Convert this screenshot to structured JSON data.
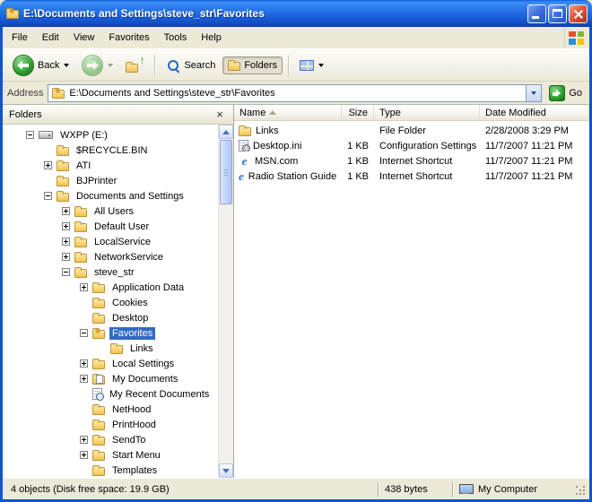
{
  "theme": {
    "titlebar_blue": "#2e7ef0",
    "window_border_blue": "#0f55cc",
    "chrome_beige": "#ece9d8",
    "selection_blue": "#316ac5",
    "close_button_red": "#da5a3c",
    "nav_button_green": "#2a9b2a"
  },
  "window": {
    "title": "E:\\Documents and Settings\\steve_str\\Favorites"
  },
  "menu": {
    "items": [
      "File",
      "Edit",
      "View",
      "Favorites",
      "Tools",
      "Help"
    ]
  },
  "toolbar": {
    "buttons": [
      {
        "label": "Back",
        "icon": "back-arrow-icon",
        "enabled": true
      },
      {
        "label": "",
        "icon": "forward-arrow-icon",
        "enabled": false
      },
      {
        "label": "",
        "icon": "up-folder-icon",
        "enabled": true
      },
      {
        "label": "Search",
        "icon": "search-icon",
        "enabled": true
      },
      {
        "label": "Folders",
        "icon": "folders-icon",
        "enabled": true,
        "pressed": true
      },
      {
        "label": "",
        "icon": "views-icon",
        "enabled": true
      }
    ]
  },
  "address": {
    "label": "Address",
    "value": "E:\\Documents and Settings\\steve_str\\Favorites",
    "go": "Go"
  },
  "folders_pane": {
    "title": "Folders",
    "tree": [
      {
        "label": "WXPP (E:)",
        "level": 0,
        "expand": "minus",
        "icon": "drive"
      },
      {
        "label": "$RECYCLE.BIN",
        "level": 1,
        "expand": "none",
        "icon": "folder"
      },
      {
        "label": "ATI",
        "level": 1,
        "expand": "plus",
        "icon": "folder"
      },
      {
        "label": "BJPrinter",
        "level": 1,
        "expand": "none",
        "icon": "folder"
      },
      {
        "label": "Documents and Settings",
        "level": 1,
        "expand": "minus",
        "icon": "folder-open"
      },
      {
        "label": "All Users",
        "level": 2,
        "expand": "plus",
        "icon": "folder"
      },
      {
        "label": "Default User",
        "level": 2,
        "expand": "plus",
        "icon": "folder"
      },
      {
        "label": "LocalService",
        "level": 2,
        "expand": "plus",
        "icon": "folder"
      },
      {
        "label": "NetworkService",
        "level": 2,
        "expand": "plus",
        "icon": "folder"
      },
      {
        "label": "steve_str",
        "level": 2,
        "expand": "minus",
        "icon": "folder-open"
      },
      {
        "label": "Application Data",
        "level": 3,
        "expand": "plus",
        "icon": "folder"
      },
      {
        "label": "Cookies",
        "level": 3,
        "expand": "none",
        "icon": "folder"
      },
      {
        "label": "Desktop",
        "level": 3,
        "expand": "none",
        "icon": "folder"
      },
      {
        "label": "Favorites",
        "level": 3,
        "expand": "minus",
        "icon": "favorites",
        "selected": true
      },
      {
        "label": "Links",
        "level": 4,
        "expand": "none",
        "icon": "folder"
      },
      {
        "label": "Local Settings",
        "level": 3,
        "expand": "plus",
        "icon": "folder"
      },
      {
        "label": "My Documents",
        "level": 3,
        "expand": "plus",
        "icon": "my-documents"
      },
      {
        "label": "My Recent Documents",
        "level": 3,
        "expand": "none",
        "icon": "recent-documents"
      },
      {
        "label": "NetHood",
        "level": 3,
        "expand": "none",
        "icon": "folder"
      },
      {
        "label": "PrintHood",
        "level": 3,
        "expand": "none",
        "icon": "folder"
      },
      {
        "label": "SendTo",
        "level": 3,
        "expand": "plus",
        "icon": "folder"
      },
      {
        "label": "Start Menu",
        "level": 3,
        "expand": "plus",
        "icon": "folder"
      },
      {
        "label": "Templates",
        "level": 3,
        "expand": "none",
        "icon": "folder"
      }
    ]
  },
  "file_list": {
    "columns": [
      "Name",
      "Size",
      "Type",
      "Date Modified"
    ],
    "sort": {
      "column": "Name",
      "direction": "ascending"
    },
    "rows": [
      {
        "name": "Links",
        "size": "",
        "type": "File Folder",
        "modified": "2/28/2008 3:29 PM",
        "icon": "folder"
      },
      {
        "name": "Desktop.ini",
        "size": "1 KB",
        "type": "Configuration Settings",
        "modified": "11/7/2007 11:21 PM",
        "icon": "ini"
      },
      {
        "name": "MSN.com",
        "size": "1 KB",
        "type": "Internet Shortcut",
        "modified": "11/7/2007 11:21 PM",
        "icon": "ie"
      },
      {
        "name": "Radio Station Guide",
        "size": "1 KB",
        "type": "Internet Shortcut",
        "modified": "11/7/2007 11:21 PM",
        "icon": "ie"
      }
    ]
  },
  "status_bar": {
    "objects": "4 objects (Disk free space: 19.9 GB)",
    "size": "438 bytes",
    "zone": "My Computer"
  }
}
